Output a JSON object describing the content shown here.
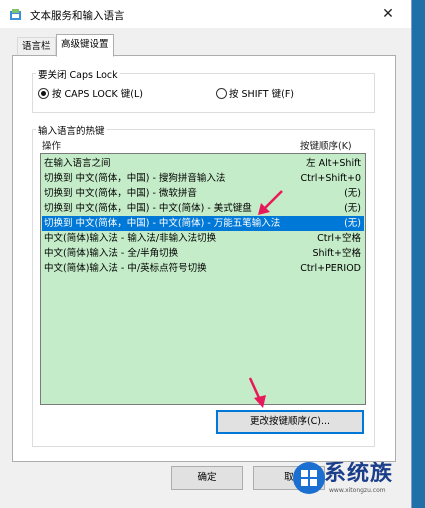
{
  "window": {
    "title": "文本服务和输入语言",
    "close_symbol": "✕"
  },
  "tabs": [
    {
      "label": "语言栏",
      "active": false
    },
    {
      "label": "高级键设置",
      "active": true
    }
  ],
  "caps_lock": {
    "group_label": "要关闭 Caps Lock",
    "options": [
      {
        "label": "按 CAPS LOCK 键(L)",
        "checked": true
      },
      {
        "label": "按 SHIFT 键(F)",
        "checked": false
      }
    ]
  },
  "hotkeys": {
    "group_label": "输入语言的热键",
    "column_action": "操作",
    "column_order": "按键顺序(K)",
    "rows": [
      {
        "action": "在输入语言之间",
        "keys": "左 Alt+Shift",
        "selected": false
      },
      {
        "action": "切换到 中文(简体，中国) - 搜狗拼音输入法",
        "keys": "Ctrl+Shift+0",
        "selected": false
      },
      {
        "action": "切换到 中文(简体，中国) - 微软拼音",
        "keys": "(无)",
        "selected": false
      },
      {
        "action": "切换到 中文(简体，中国) - 中文(简体) - 美式键盘",
        "keys": "(无)",
        "selected": false
      },
      {
        "action": "切换到 中文(简体，中国) - 中文(简体) - 万能五笔输入法",
        "keys": "(无)",
        "selected": true
      },
      {
        "action": "中文(简体)输入法 - 输入法/非输入法切换",
        "keys": "Ctrl+空格",
        "selected": false
      },
      {
        "action": "中文(简体)输入法 - 全/半角切换",
        "keys": "Shift+空格",
        "selected": false
      },
      {
        "action": "中文(简体)输入法 - 中/英标点符号切换",
        "keys": "Ctrl+PERIOD",
        "selected": false
      }
    ],
    "change_order_button": "更改按键顺序(C)..."
  },
  "footer": {
    "ok": "确定",
    "cancel": "取"
  },
  "watermark": {
    "text": "系统族",
    "url": "www.xitongzu.com"
  },
  "colors": {
    "list_background": "#c4ecc8",
    "selection": "#0078d7",
    "arrow": "#e8195a",
    "desktop": "#1f6fa8"
  }
}
